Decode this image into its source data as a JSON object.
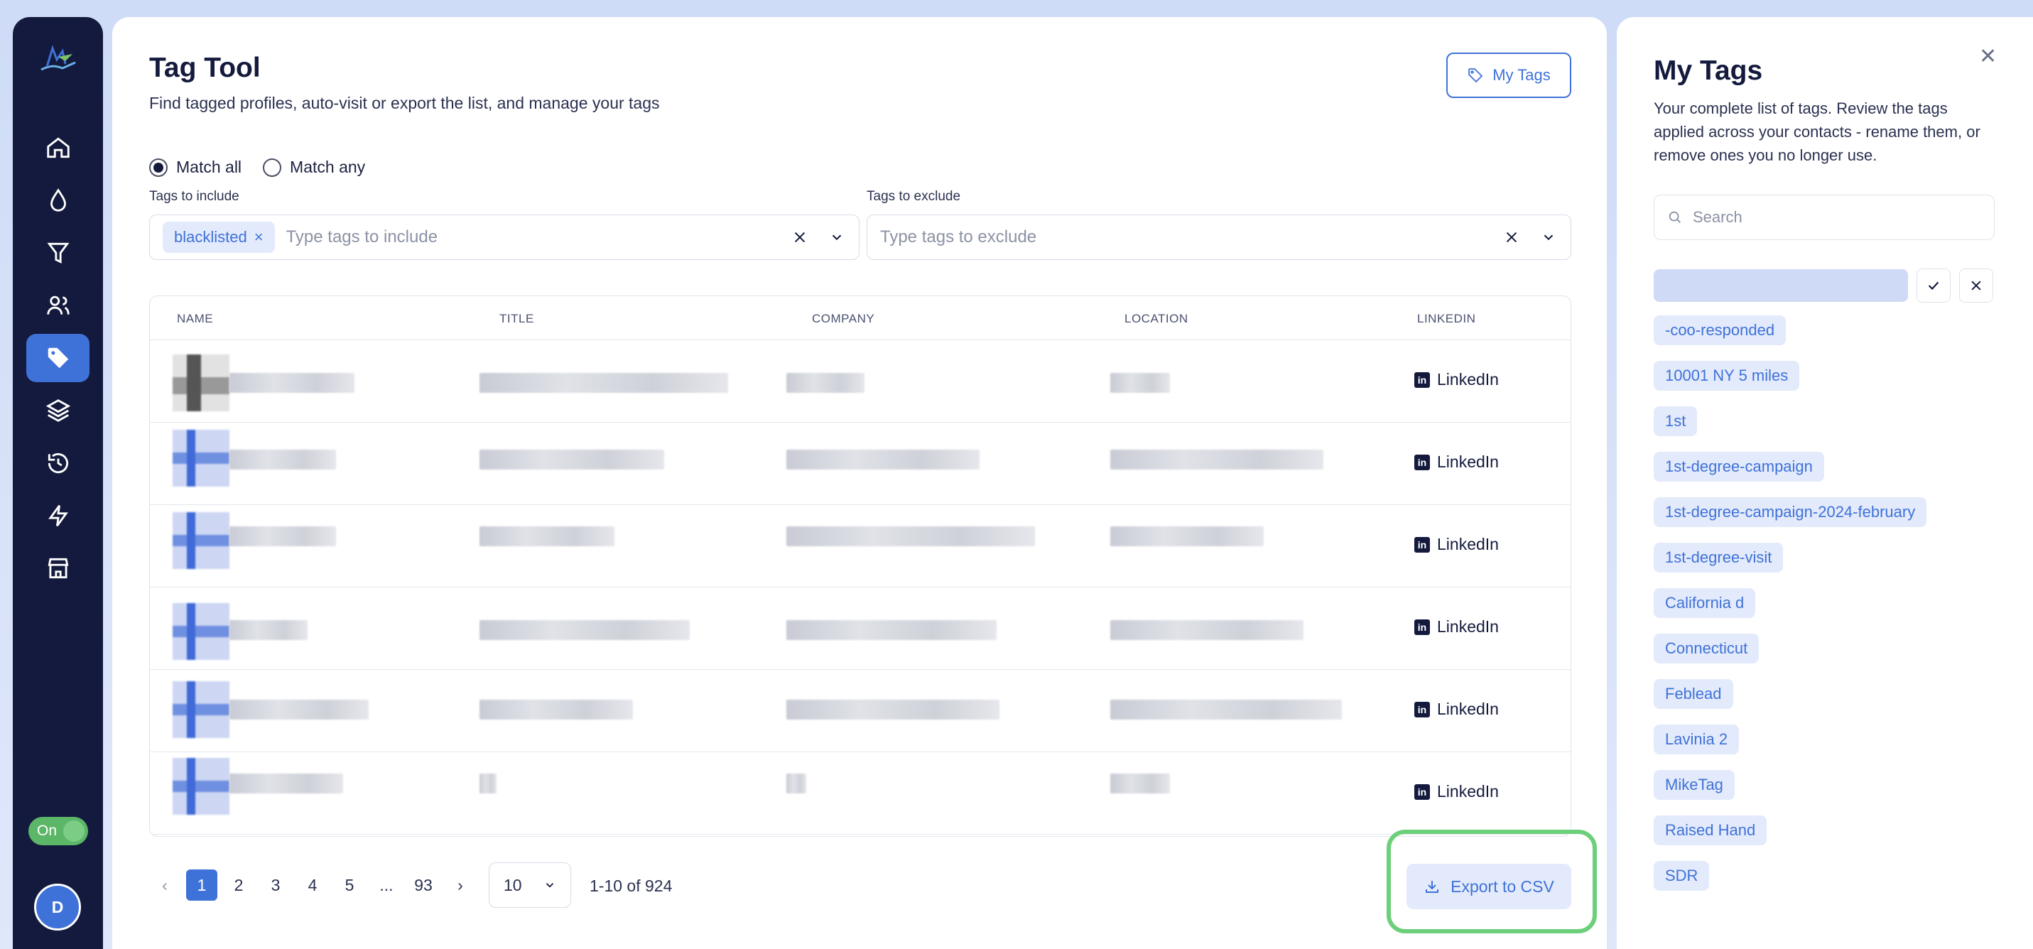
{
  "sidebar": {
    "icons": [
      "home-icon",
      "droplet-icon",
      "funnel-icon",
      "users-icon",
      "tag-icon",
      "layers-icon",
      "history-icon",
      "bolt-icon",
      "store-icon"
    ],
    "active_index": 4,
    "toggle_label": "On",
    "avatar_initial": "D",
    "accent": "#3f72d8",
    "bg": "#141a3d"
  },
  "header": {
    "title": "Tag Tool",
    "subtitle": "Find tagged profiles, auto-visit or export the list, and manage your tags",
    "my_tags_button": "My Tags"
  },
  "filters": {
    "match_all": "Match all",
    "match_any": "Match any",
    "selected_match": "all",
    "include_label": "Tags to include",
    "include_chip": "blacklisted",
    "include_placeholder": "Type tags to include",
    "exclude_label": "Tags to exclude",
    "exclude_placeholder": "Type tags to exclude"
  },
  "table": {
    "columns": [
      "NAME",
      "TITLE",
      "COMPANY",
      "LOCATION",
      "LINKEDIN"
    ],
    "linkedin_label": "LinkedIn",
    "row_count": 6
  },
  "pagination": {
    "pages": [
      "1",
      "2",
      "3",
      "4",
      "5",
      "...",
      "93"
    ],
    "current": "1",
    "per_page": "10",
    "range": "1-10 of 924",
    "export_label": "Export to CSV"
  },
  "tags_panel": {
    "title": "My Tags",
    "description": "Your complete list of tags. Review the tags applied across your contacts - rename them, or remove ones you no longer use.",
    "search_placeholder": "Search",
    "tags": [
      "-coo-responded",
      "10001 NY 5 miles",
      "1st",
      "1st-degree-campaign",
      "1st-degree-campaign-2024-february",
      "1st-degree-visit",
      "California d",
      "Connecticut",
      "Feblead",
      "Lavinia 2",
      "MikeTag",
      "Raised Hand",
      "SDR"
    ]
  }
}
